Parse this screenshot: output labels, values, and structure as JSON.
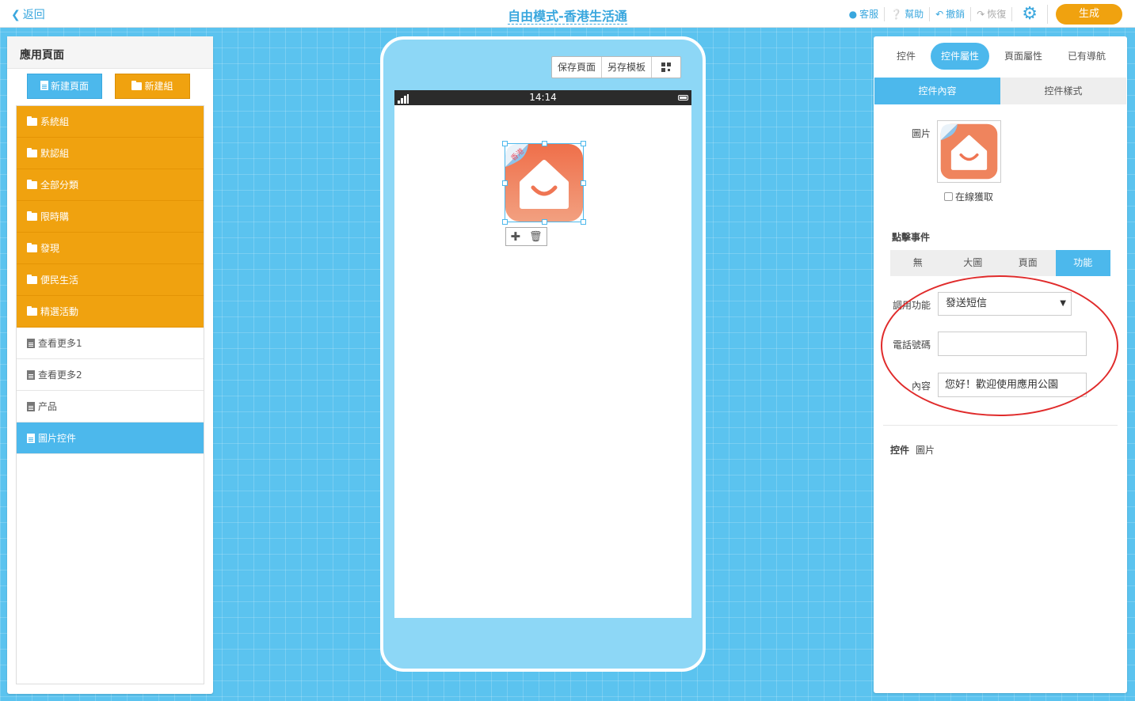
{
  "header": {
    "back_label": "返回",
    "title": "自由模式-香港生活通",
    "actions": [
      {
        "icon": "user-icon",
        "label": "客服"
      },
      {
        "icon": "help-icon",
        "label": "幫助"
      },
      {
        "icon": "undo-icon",
        "label": "撤銷"
      },
      {
        "icon": "redo-icon",
        "label": "恢復"
      }
    ],
    "generate_label": "生成"
  },
  "sidebar": {
    "title": "應用頁面",
    "new_page_label": "新建頁面",
    "new_group_label": "新建組",
    "folders": [
      "系統組",
      "默認組",
      "全部分類",
      "限時購",
      "發現",
      "便民生活",
      "精選活動"
    ],
    "pages": [
      "查看更多1",
      "查看更多2",
      "产品",
      "圖片控件"
    ],
    "active_page": "圖片控件"
  },
  "phone": {
    "tools": {
      "save_page": "保存頁面",
      "save_template": "另存模板"
    },
    "status_time": "14:14",
    "image_badge": "香港"
  },
  "inspector": {
    "tabs": [
      "控件",
      "控件屬性",
      "頁面屬性",
      "已有導航"
    ],
    "active_tab": "控件屬性",
    "sub_tabs": [
      "控件內容",
      "控件樣式"
    ],
    "image_label": "圖片",
    "online_fetch_label": "在線獲取",
    "click_event_label": "點擊事件",
    "events": [
      "無",
      "大圖",
      "頁面",
      "功能"
    ],
    "active_event": "功能",
    "function_label": "調用功能",
    "function_value": "發送短信",
    "phone_label": "電話號碼",
    "phone_value": "",
    "content_label": "內容",
    "content_value": "您好！歡迎使用應用公園",
    "control_label": "控件",
    "control_value": "圖片"
  },
  "colors": {
    "accent": "#4cb8ec",
    "folder": "#f0a20f",
    "canvas": "#5bc3ef",
    "highlight": "#e02b2b"
  }
}
